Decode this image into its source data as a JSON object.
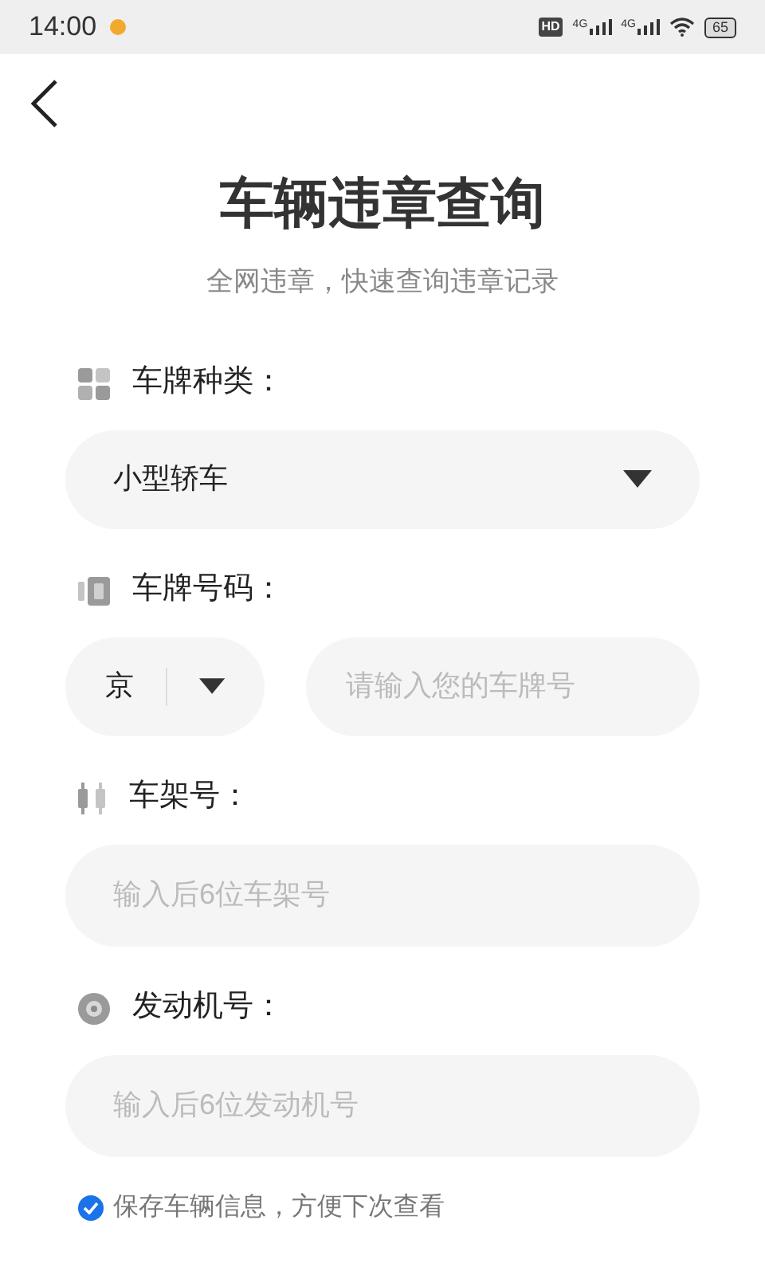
{
  "status_bar": {
    "time": "14:00",
    "network_labels": [
      "4G",
      "4G"
    ],
    "hd_label": "HD",
    "battery": "65"
  },
  "title": "车辆违章查询",
  "subtitle": "全网违章，快速查询违章记录",
  "fields": [
    {
      "kind": "select",
      "label": "车牌种类：",
      "value": "小型轿车"
    },
    {
      "kind": "plate",
      "label": "车牌号码：",
      "province": "京",
      "placeholder": "请输入您的车牌号"
    },
    {
      "kind": "input",
      "label": "车架号：",
      "placeholder": "输入后6位车架号"
    },
    {
      "kind": "input",
      "label": "发动机号：",
      "placeholder": "输入后6位发动机号"
    }
  ],
  "save_option": {
    "label": "保存车辆信息，方便下次查看",
    "checked": true
  }
}
